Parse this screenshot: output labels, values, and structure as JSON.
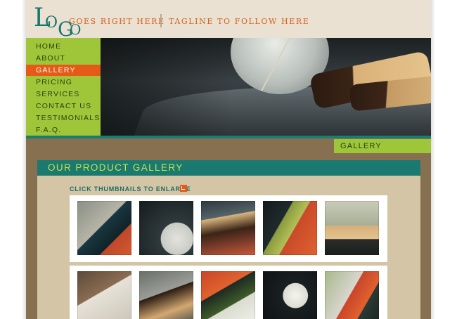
{
  "header": {
    "logo_letters": [
      "L",
      "O",
      "G",
      "O"
    ],
    "goes_text": "GOES RIGHT HERE",
    "tagline": "TAGLINE TO FOLLOW HERE"
  },
  "nav": {
    "items": [
      {
        "label": "HOME",
        "active": false
      },
      {
        "label": "ABOUT",
        "active": false
      },
      {
        "label": "GALLERY",
        "active": true
      },
      {
        "label": "PRICING",
        "active": false
      },
      {
        "label": "SERVICES",
        "active": false
      },
      {
        "label": "CONTACT US",
        "active": false
      },
      {
        "label": "TESTIMONIALS",
        "active": false
      },
      {
        "label": "F.A.Q.",
        "active": false
      }
    ]
  },
  "breadcrumb": "GALLERY",
  "gallery": {
    "title": "OUR PRODUCT GALLERY",
    "instruction": "CLICK THUMBNAILS TO ENLARGE",
    "enlarge_icon": "enlarge-icon"
  },
  "colors": {
    "accent_orange": "#e65a18",
    "nav_green": "#9fc638",
    "teal": "#1b7a6f",
    "page_brown": "#87704f",
    "panel_tan": "#d4c5a6"
  }
}
